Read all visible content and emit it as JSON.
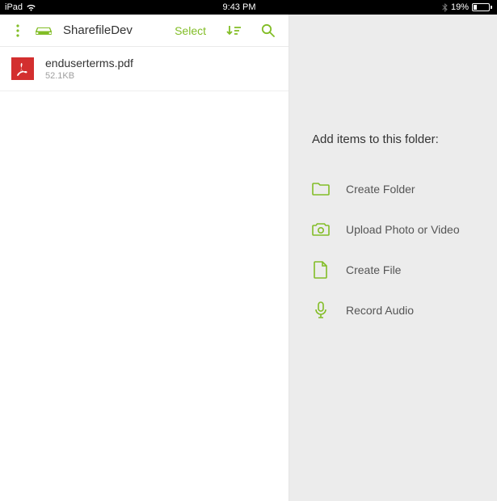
{
  "status": {
    "device": "iPad",
    "time": "9:43 PM",
    "battery_pct": "19%"
  },
  "toolbar": {
    "title": "SharefileDev",
    "select_label": "Select"
  },
  "files": [
    {
      "name": "enduserterms.pdf",
      "size": "52.1KB"
    }
  ],
  "panel": {
    "title": "Add items to this folder:",
    "actions": [
      {
        "icon": "folder",
        "label": "Create Folder"
      },
      {
        "icon": "camera",
        "label": "Upload Photo or Video"
      },
      {
        "icon": "file",
        "label": "Create File"
      },
      {
        "icon": "mic",
        "label": "Record Audio"
      }
    ]
  }
}
